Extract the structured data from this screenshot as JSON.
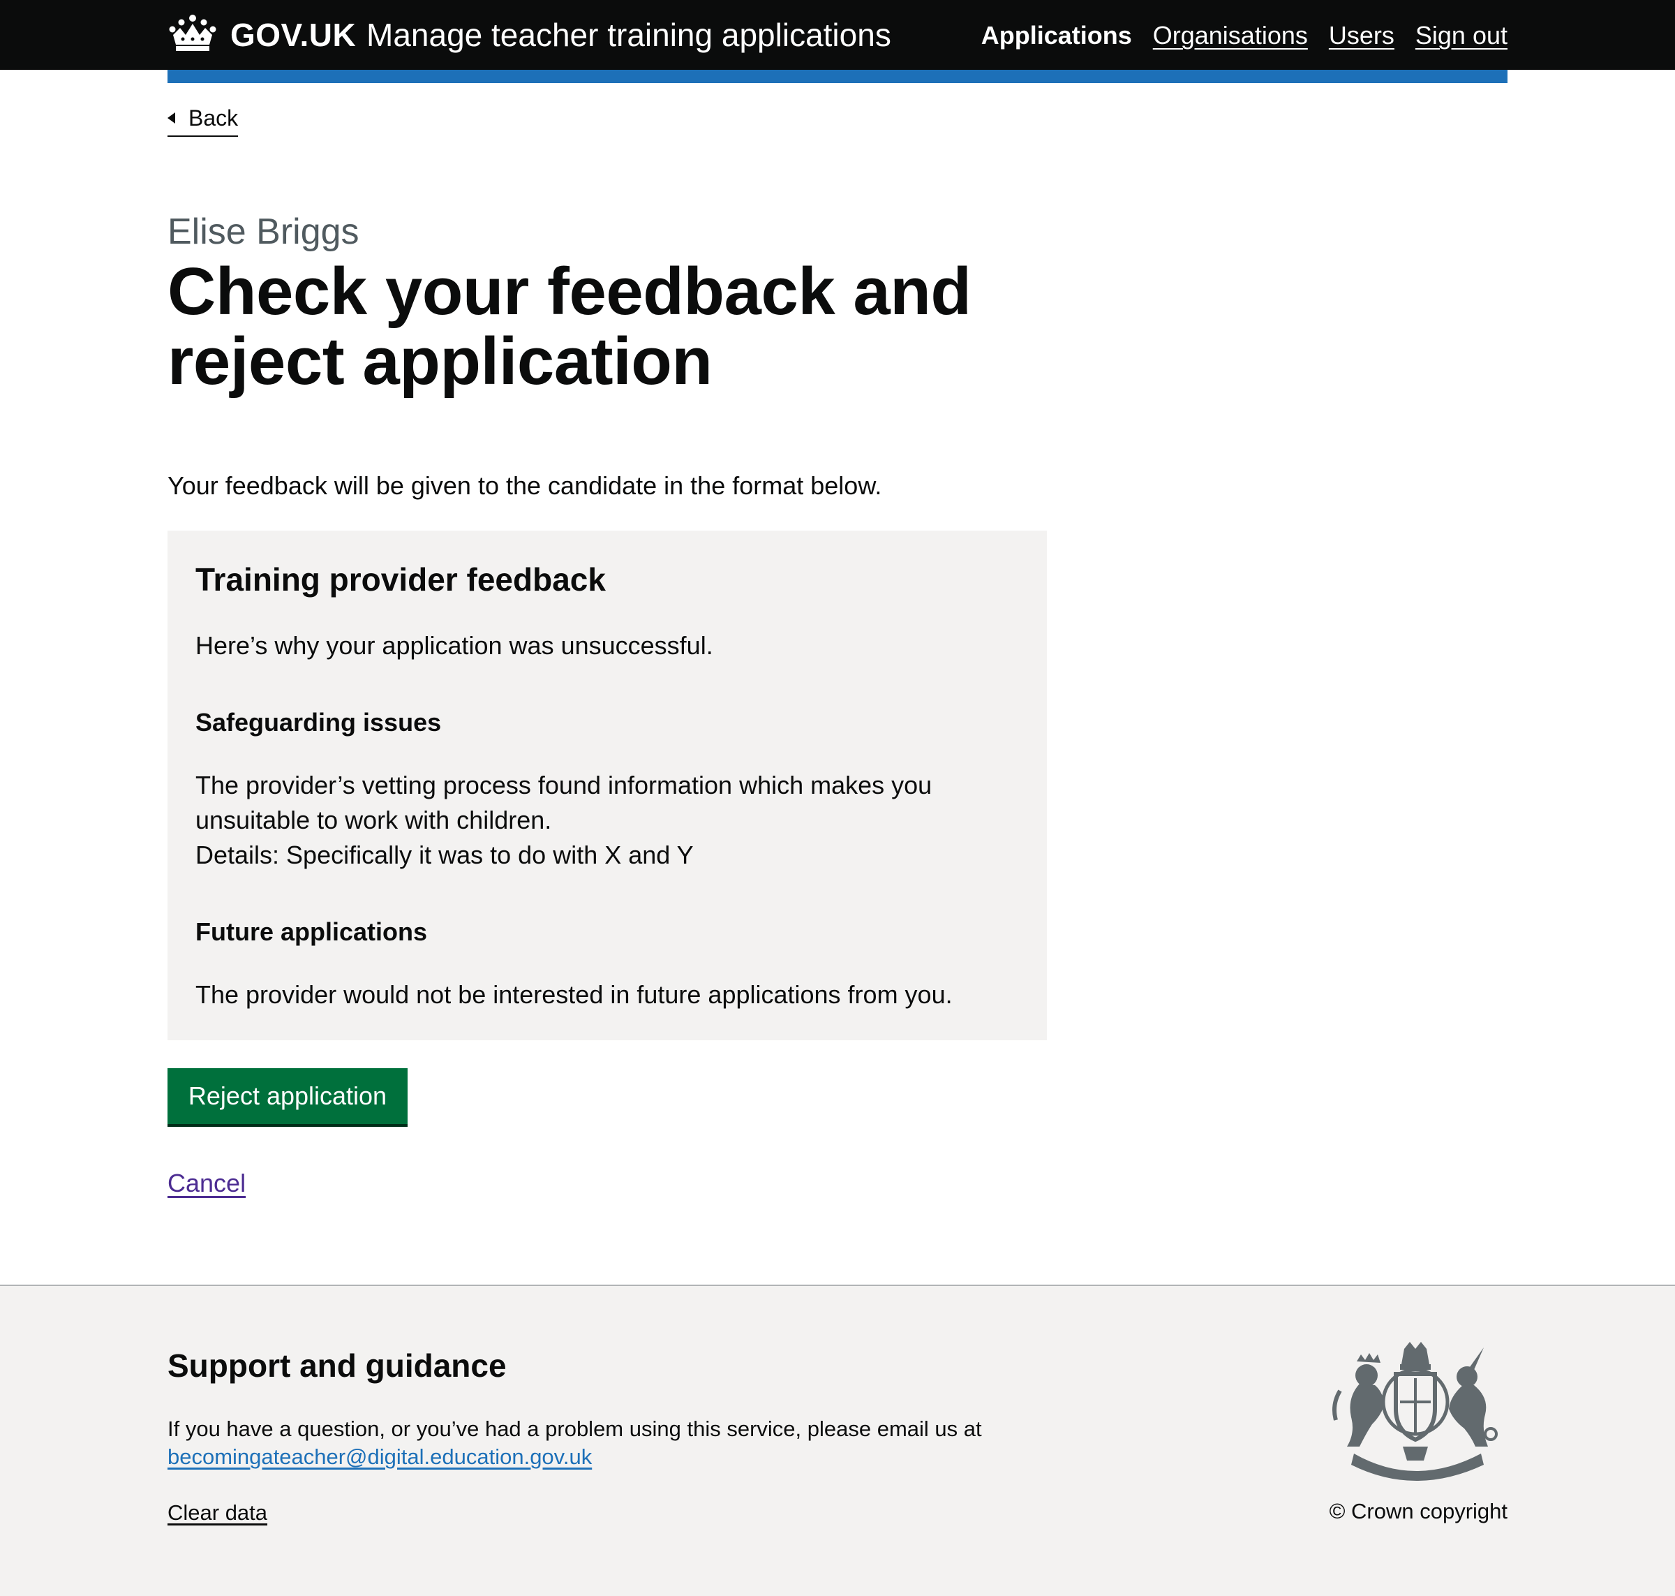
{
  "header": {
    "logotype": "GOV.UK",
    "service_name": "Manage teacher training applications",
    "nav": [
      {
        "label": "Applications",
        "active": true
      },
      {
        "label": "Organisations",
        "active": false
      },
      {
        "label": "Users",
        "active": false
      },
      {
        "label": "Sign out",
        "active": false
      }
    ]
  },
  "back_link": "Back",
  "caption": "Elise Briggs",
  "title": "Check your feedback and reject application",
  "intro": "Your feedback will be given to the candidate in the format below.",
  "feedback_panel": {
    "title": "Training provider feedback",
    "intro": "Here’s why your application was unsuccessful.",
    "sections": [
      {
        "heading": "Safeguarding issues",
        "lines": [
          "The provider’s vetting process found information which makes you",
          "unsuitable to work with children.",
          "Details: Specifically it was to do with X and Y"
        ]
      },
      {
        "heading": "Future applications",
        "lines": [
          "The provider would not be interested in future applications from you."
        ]
      }
    ]
  },
  "actions": {
    "reject_label": "Reject application",
    "cancel_label": "Cancel"
  },
  "footer": {
    "title": "Support and guidance",
    "text": "If you have a question, or you’ve had a problem using this service, please email us at",
    "email": "becomingateacher@digital.education.gov.uk",
    "clear_data": "Clear data",
    "copyright": "© Crown copyright"
  },
  "icons": {
    "crown": "crown-icon",
    "back": "chevron-left-icon",
    "crest": "royal-coat-of-arms"
  },
  "colors": {
    "header_bg": "#0b0c0c",
    "accent_blue": "#1d70b8",
    "button_green": "#00703c",
    "panel_bg": "#f3f2f1",
    "visited_link": "#4c2c92",
    "caption_grey": "#505a5f"
  }
}
